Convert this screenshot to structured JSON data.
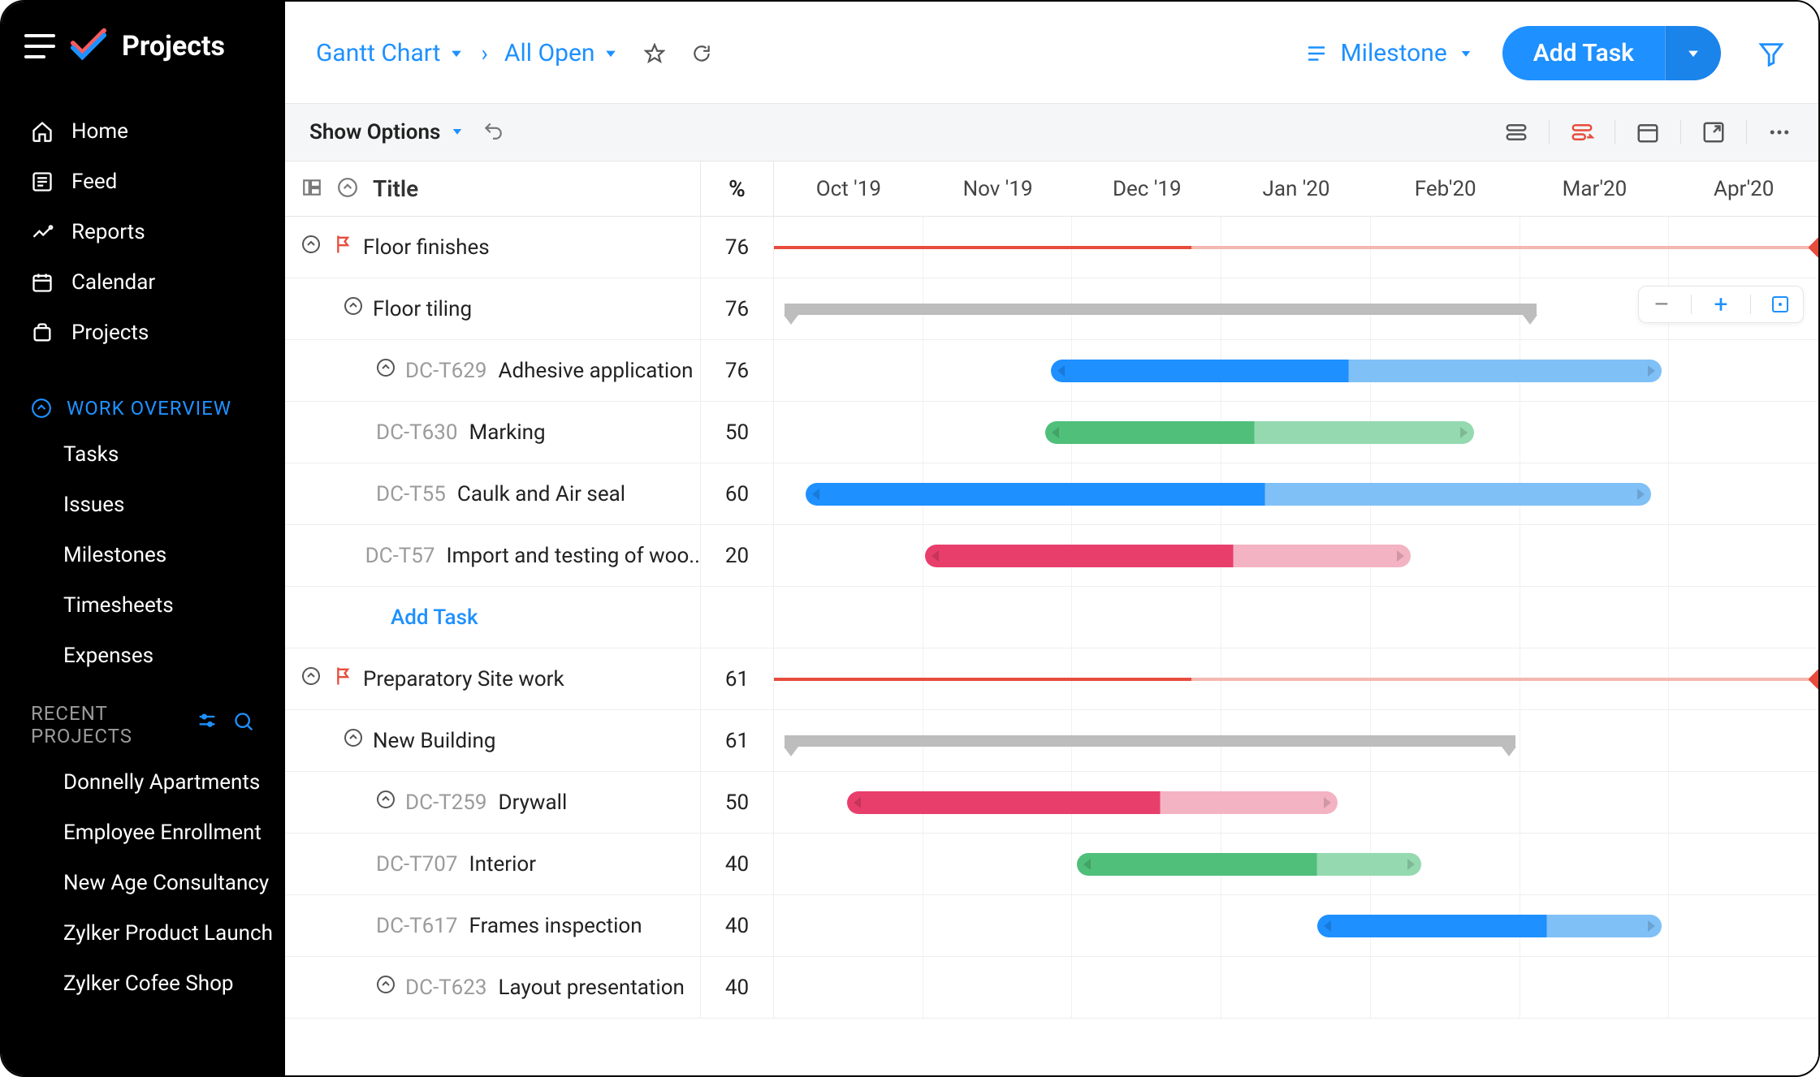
{
  "brand": {
    "name": "Projects"
  },
  "sidebar": {
    "nav": [
      {
        "label": "Home"
      },
      {
        "label": "Feed"
      },
      {
        "label": "Reports"
      },
      {
        "label": "Calendar"
      },
      {
        "label": "Projects"
      }
    ],
    "workOverview": {
      "title": "WORK OVERVIEW",
      "items": [
        {
          "label": "Tasks"
        },
        {
          "label": "Issues"
        },
        {
          "label": "Milestones"
        },
        {
          "label": "Timesheets"
        },
        {
          "label": "Expenses"
        }
      ]
    },
    "recent": {
      "title": "RECENT PROJECTS",
      "items": [
        {
          "label": "Donnelly Apartments"
        },
        {
          "label": "Employee Enrollment"
        },
        {
          "label": "New Age Consultancy"
        },
        {
          "label": "Zylker Product Launch"
        },
        {
          "label": "Zylker Cofee Shop"
        }
      ]
    }
  },
  "topbar": {
    "view": "Gantt Chart",
    "filter": "All Open",
    "groupBy": "Milestone",
    "addTask": "Add Task"
  },
  "optbar": {
    "show": "Show Options"
  },
  "columns": {
    "title": "Title",
    "pct": "%"
  },
  "timeline": {
    "months": [
      "Oct '19",
      "Nov '19",
      "Dec '19",
      "Jan '20",
      "Feb'20",
      "Mar'20",
      "Apr'20"
    ],
    "count": 7
  },
  "zoom": {
    "minus": "–",
    "plus": "+"
  },
  "rows": [
    {
      "type": "milestone",
      "indent": 0,
      "title": "Floor finishes",
      "pct": "76",
      "ms": {
        "startPct": 0,
        "endPct": 100,
        "progressPct": 40
      }
    },
    {
      "type": "summary",
      "indent": 1,
      "title": "Floor tiling",
      "pct": "76",
      "sum": {
        "startPct": 1,
        "endPct": 73
      }
    },
    {
      "type": "task",
      "indent": 2,
      "id": "DC-T629",
      "title": "Adhesive application",
      "pct": "76",
      "bar": {
        "startPct": 26.5,
        "endPct": 85,
        "progPct": 55,
        "color": "#1e90ff",
        "light": "#7fc0f7"
      }
    },
    {
      "type": "task",
      "indent": 2,
      "id": "DC-T630",
      "title": "Marking",
      "pct": "50",
      "bar": {
        "startPct": 26,
        "endPct": 67,
        "progPct": 46,
        "color": "#4fbf7a",
        "light": "#95d9b0"
      }
    },
    {
      "type": "task",
      "indent": 2,
      "id": "DC-T55",
      "title": "Caulk and Air seal",
      "pct": "60",
      "bar": {
        "startPct": 3,
        "endPct": 84,
        "progPct": 47,
        "color": "#1e90ff",
        "light": "#7fc0f7"
      }
    },
    {
      "type": "task",
      "indent": 2,
      "id": "DC-T57",
      "title": "Import and testing of woo..",
      "pct": "20",
      "bar": {
        "startPct": 14.5,
        "endPct": 61,
        "progPct": 44,
        "color": "#e83e6b",
        "light": "#f4b3c2"
      }
    },
    {
      "type": "addtask",
      "label": "Add Task"
    },
    {
      "type": "milestone",
      "indent": 0,
      "title": "Preparatory Site work",
      "pct": "61",
      "ms": {
        "startPct": 0,
        "endPct": 100,
        "progressPct": 40
      }
    },
    {
      "type": "summary",
      "indent": 1,
      "title": "New Building",
      "pct": "61",
      "sum": {
        "startPct": 1,
        "endPct": 71
      }
    },
    {
      "type": "task",
      "indent": 2,
      "id": "DC-T259",
      "title": "Drywall",
      "pct": "50",
      "bar": {
        "startPct": 7,
        "endPct": 54,
        "progPct": 37,
        "color": "#e83e6b",
        "light": "#f4b3c2"
      }
    },
    {
      "type": "task",
      "indent": 2,
      "id": "DC-T707",
      "title": "Interior",
      "pct": "40",
      "bar": {
        "startPct": 29,
        "endPct": 62,
        "progPct": 52,
        "color": "#4fbf7a",
        "light": "#95d9b0"
      }
    },
    {
      "type": "task",
      "indent": 2,
      "id": "DC-T617",
      "title": "Frames inspection",
      "pct": "40",
      "bar": {
        "startPct": 52,
        "endPct": 85,
        "progPct": 74,
        "color": "#1e90ff",
        "light": "#7fc0f7"
      }
    },
    {
      "type": "task",
      "indent": 2,
      "id": "DC-T623",
      "title": "Layout presentation",
      "pct": "40"
    }
  ]
}
